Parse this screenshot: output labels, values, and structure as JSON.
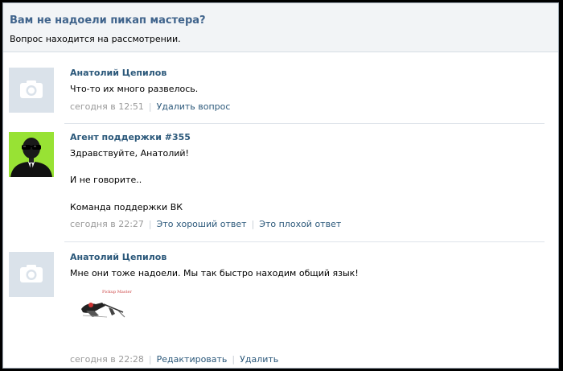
{
  "header": {
    "title": "Вам не надоели пикап мастера?",
    "subtitle": "Вопрос находится на рассмотрении."
  },
  "posts": [
    {
      "author": "Анатолий Цепилов",
      "text": [
        "Что-то их много развелось."
      ],
      "time": "сегодня в 12:51",
      "actions": [
        "Удалить вопрос"
      ]
    },
    {
      "author": "Агент поддержки #355",
      "text": [
        "Здравствуйте, Анатолий!",
        "И не говорите..",
        "Команда поддержки ВК"
      ],
      "time": "сегодня в 22:27",
      "actions": [
        "Это хороший ответ",
        "Это плохой ответ"
      ]
    },
    {
      "author": "Анатолий Цепилов",
      "text": [
        "Мне они тоже надоели. Мы так быстро находим общий язык!"
      ],
      "attachment_caption": "Pickup Master",
      "time": "сегодня в 22:28",
      "actions": [
        "Редактировать",
        "Удалить"
      ]
    }
  ],
  "colors": {
    "link": "#2b587a",
    "title": "#40648c",
    "meta": "#999999",
    "avatar_placeholder": "#dae2ea",
    "agent_avatar_bg": "#98e234"
  },
  "icons": {
    "placeholder_avatar": "camera-icon",
    "agent_avatar": "agent-in-suit-icon"
  }
}
